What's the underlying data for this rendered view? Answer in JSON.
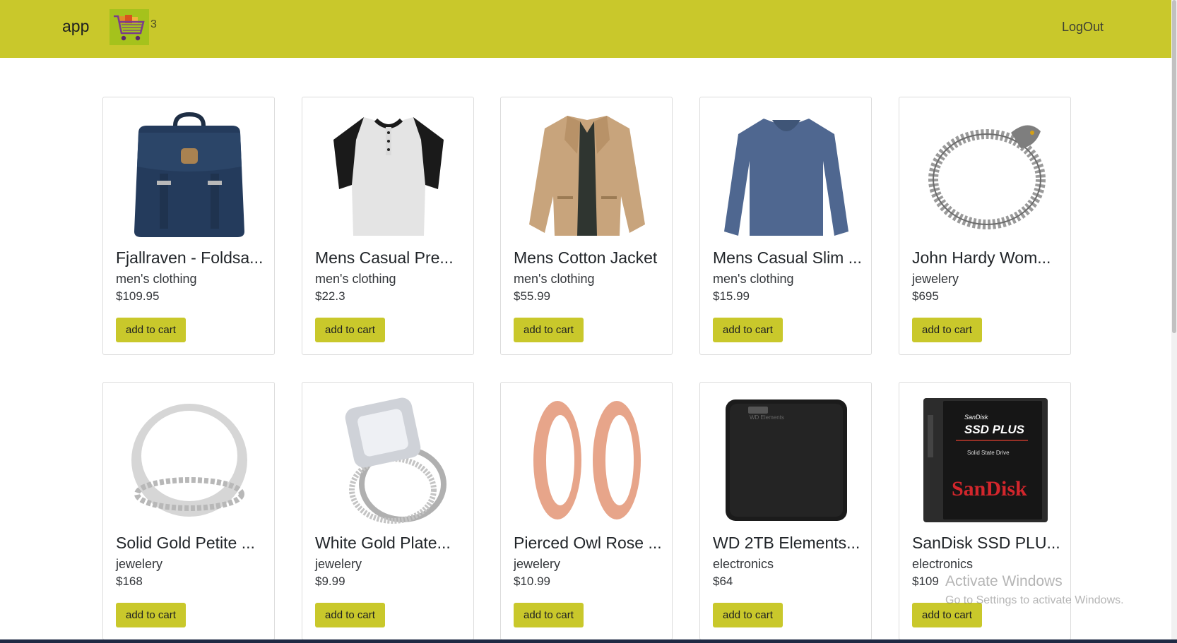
{
  "navbar": {
    "brand": "app",
    "cart_icon": "shopping-cart-icon",
    "cart_count": "3",
    "logout_label": "LogOut",
    "accent_color": "#c9c82b"
  },
  "products": [
    {
      "title": "Fjallraven - Foldsa...",
      "category": "men's clothing",
      "price": "$109.95",
      "button": "add to cart",
      "image": "backpack-image"
    },
    {
      "title": "Mens Casual Pre...",
      "category": "men's clothing",
      "price": "$22.3",
      "button": "add to cart",
      "image": "raglan-shirt-image"
    },
    {
      "title": "Mens Cotton Jacket",
      "category": "men's clothing",
      "price": "$55.99",
      "button": "add to cart",
      "image": "jacket-image"
    },
    {
      "title": "Mens Casual Slim ...",
      "category": "men's clothing",
      "price": "$15.99",
      "button": "add to cart",
      "image": "long-sleeve-shirt-image"
    },
    {
      "title": "John Hardy Wom...",
      "category": "jewelery",
      "price": "$695",
      "button": "add to cart",
      "image": "dragon-bracelet-image"
    },
    {
      "title": "Solid Gold Petite ...",
      "category": "jewelery",
      "price": "$168",
      "button": "add to cart",
      "image": "silver-ring-image"
    },
    {
      "title": "White Gold Plate...",
      "category": "jewelery",
      "price": "$9.99",
      "button": "add to cart",
      "image": "engagement-ring-image"
    },
    {
      "title": "Pierced Owl Rose ...",
      "category": "jewelery",
      "price": "$10.99",
      "button": "add to cart",
      "image": "rose-gold-plugs-image"
    },
    {
      "title": "WD 2TB Elements...",
      "category": "electronics",
      "price": "$64",
      "button": "add to cart",
      "image": "external-hard-drive-image"
    },
    {
      "title": "SanDisk SSD PLU...",
      "category": "electronics",
      "price": "$109",
      "button": "add to cart",
      "image": "ssd-image"
    }
  ],
  "ssd_label": {
    "brand_small": "SanDisk",
    "model": "SSD PLUS",
    "subtitle": "Solid State Drive",
    "brand": "SanDisk"
  },
  "hdd_label": {
    "brand": "WD Elements"
  },
  "watermark": {
    "line1": "Activate Windows",
    "line2": "Go to Settings to activate Windows."
  }
}
